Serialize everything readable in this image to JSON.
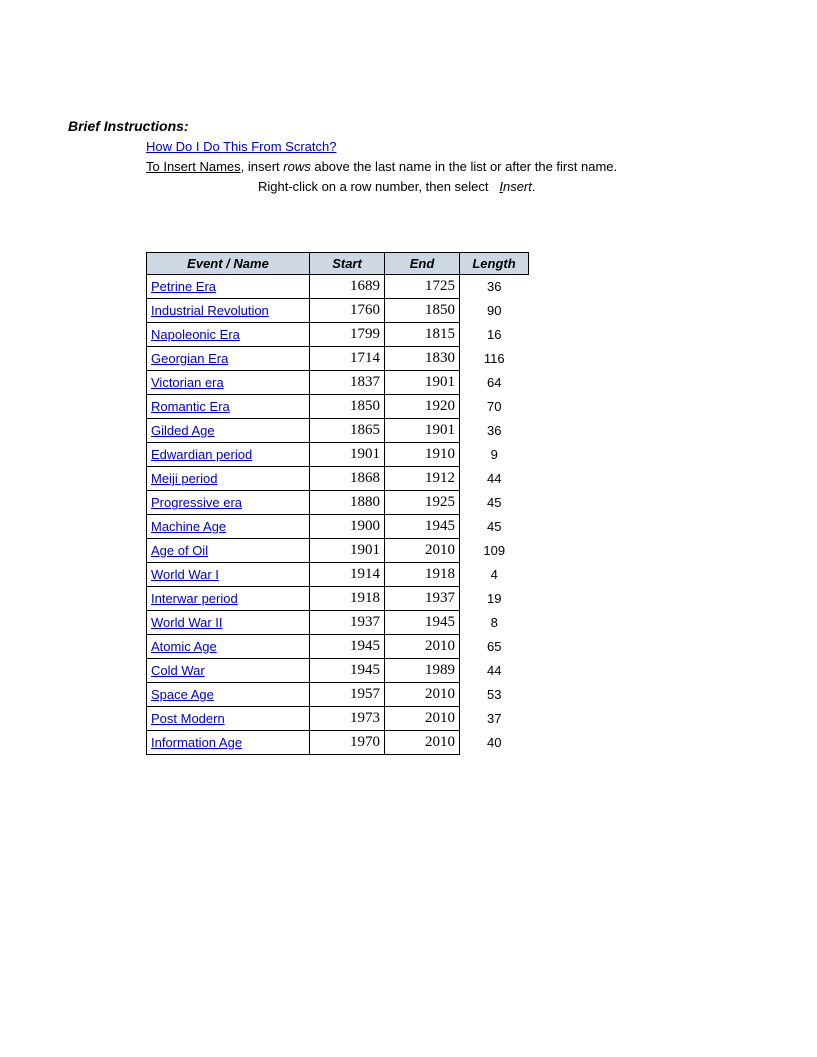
{
  "header": {
    "title": "Brief Instructions:",
    "link": "How Do I Do This From Scratch?",
    "line2_a": "To Insert Names",
    "line2_b": ", insert ",
    "line2_c": "rows",
    "line2_d": " above the last name in the list or after the first name.",
    "line3_a": "Right-click on a row number, then select ",
    "line3_b": "Insert",
    "line3_c": "."
  },
  "table": {
    "headers": {
      "name": "Event / Name",
      "start": "Start",
      "end": "End",
      "length": "Length"
    },
    "rows": [
      {
        "name": "Petrine Era",
        "start": "1689",
        "end": "1725",
        "length": "36"
      },
      {
        "name": "Industrial Revolution",
        "start": "1760",
        "end": "1850",
        "length": "90"
      },
      {
        "name": "Napoleonic Era",
        "start": "1799",
        "end": "1815",
        "length": "16"
      },
      {
        "name": "Georgian Era",
        "start": "1714",
        "end": "1830",
        "length": "116"
      },
      {
        "name": "Victorian era",
        "start": "1837",
        "end": "1901",
        "length": "64"
      },
      {
        "name": "Romantic Era",
        "start": "1850",
        "end": "1920",
        "length": "70"
      },
      {
        "name": "Gilded Age",
        "start": "1865",
        "end": "1901",
        "length": "36"
      },
      {
        "name": "Edwardian period",
        "start": "1901",
        "end": "1910",
        "length": "9"
      },
      {
        "name": "Meiji period",
        "start": "1868",
        "end": "1912",
        "length": "44"
      },
      {
        "name": "Progressive era",
        "start": "1880",
        "end": "1925",
        "length": "45"
      },
      {
        "name": "Machine Age",
        "start": "1900",
        "end": "1945",
        "length": "45"
      },
      {
        "name": "Age of Oil",
        "start": "1901",
        "end": "2010",
        "length": "109"
      },
      {
        "name": "World War I",
        "start": "1914",
        "end": "1918",
        "length": "4"
      },
      {
        "name": "Interwar period",
        "start": "1918",
        "end": "1937",
        "length": "19"
      },
      {
        "name": "World War II",
        "start": "1937",
        "end": "1945",
        "length": "8"
      },
      {
        "name": "Atomic Age",
        "start": "1945",
        "end": "2010",
        "length": "65"
      },
      {
        "name": "Cold War",
        "start": "1945",
        "end": "1989",
        "length": "44"
      },
      {
        "name": "Space Age",
        "start": "1957",
        "end": "2010",
        "length": "53"
      },
      {
        "name": "Post Modern",
        "start": "1973",
        "end": "2010",
        "length": "37"
      },
      {
        "name": "Information Age",
        "start": "1970",
        "end": "2010",
        "length": "40"
      }
    ]
  }
}
